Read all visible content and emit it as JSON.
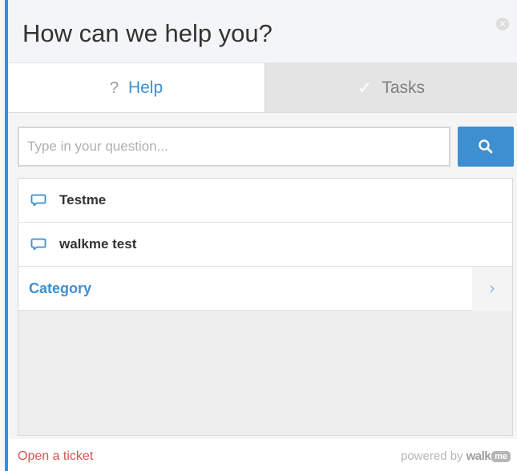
{
  "header": {
    "title": "How can we help you?",
    "close_icon": "close-icon"
  },
  "tabs": [
    {
      "label": "Help",
      "icon": "question-mark-icon",
      "glyph": "?",
      "active": true
    },
    {
      "label": "Tasks",
      "icon": "checkmark-icon",
      "glyph": "✓",
      "active": false
    }
  ],
  "search": {
    "placeholder": "Type in your question...",
    "value": "",
    "button_icon": "search-icon"
  },
  "list": {
    "items": [
      {
        "label": "Testme",
        "icon": "chat-bubble-icon"
      },
      {
        "label": "walkme test",
        "icon": "chat-bubble-icon"
      }
    ],
    "category": {
      "label": "Category",
      "icon": "chevron-right-icon",
      "glyph": "›"
    }
  },
  "footer": {
    "open_ticket": "Open a ticket",
    "powered_by": "powered by",
    "brand": "walk",
    "brand_badge": "me"
  },
  "colors": {
    "accent": "#3d8fd1",
    "ticket_link": "#d9534f"
  }
}
